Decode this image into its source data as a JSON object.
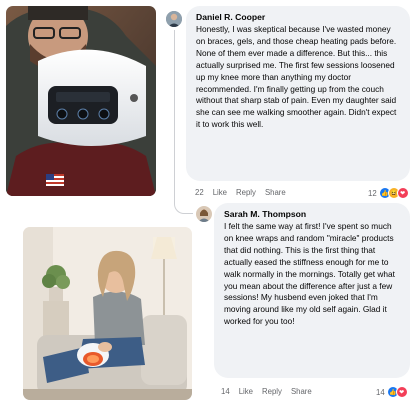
{
  "comments": [
    {
      "author": "Daniel R. Cooper",
      "text": "Honestly, I was skeptical because I've wasted money on braces, gels, and those cheap heating pads before. None of them ever made a difference. But this... this actually surprised me. The first few sessions loosened up my knee more than anything my doctor recommended. I'm finally getting up from the couch without that sharp stab of pain. Even my daughter said she can see me walking smoother again. Didn't expect it to work this well.",
      "time": "22",
      "like_label": "Like",
      "reply_label": "Reply",
      "share_label": "Share",
      "reaction_count": "12"
    },
    {
      "author": "Sarah M. Thompson",
      "text": "I felt the same way at first! I've spent so much on knee wraps and random \"miracle\" products that did nothing. This is the first thing that actually eased the stiffness enough for me to walk normally in the mornings. Totally get what you mean about the difference after just a few sessions! My husbend even joked that I'm moving around like my old self again. Glad it worked for you too!",
      "time": "14",
      "like_label": "Like",
      "reply_label": "Reply",
      "share_label": "Share",
      "reaction_count": "14"
    }
  ],
  "colors": {
    "bubble": "#f0f2f5",
    "meta_text": "#65676b",
    "like_blue": "#1877f2",
    "heart_red": "#f33e58",
    "emoji_yellow": "#f7b125"
  },
  "icons": [
    "like-reaction-icon",
    "heart-reaction-icon",
    "haha-reaction-icon",
    "sad-reaction-icon"
  ]
}
